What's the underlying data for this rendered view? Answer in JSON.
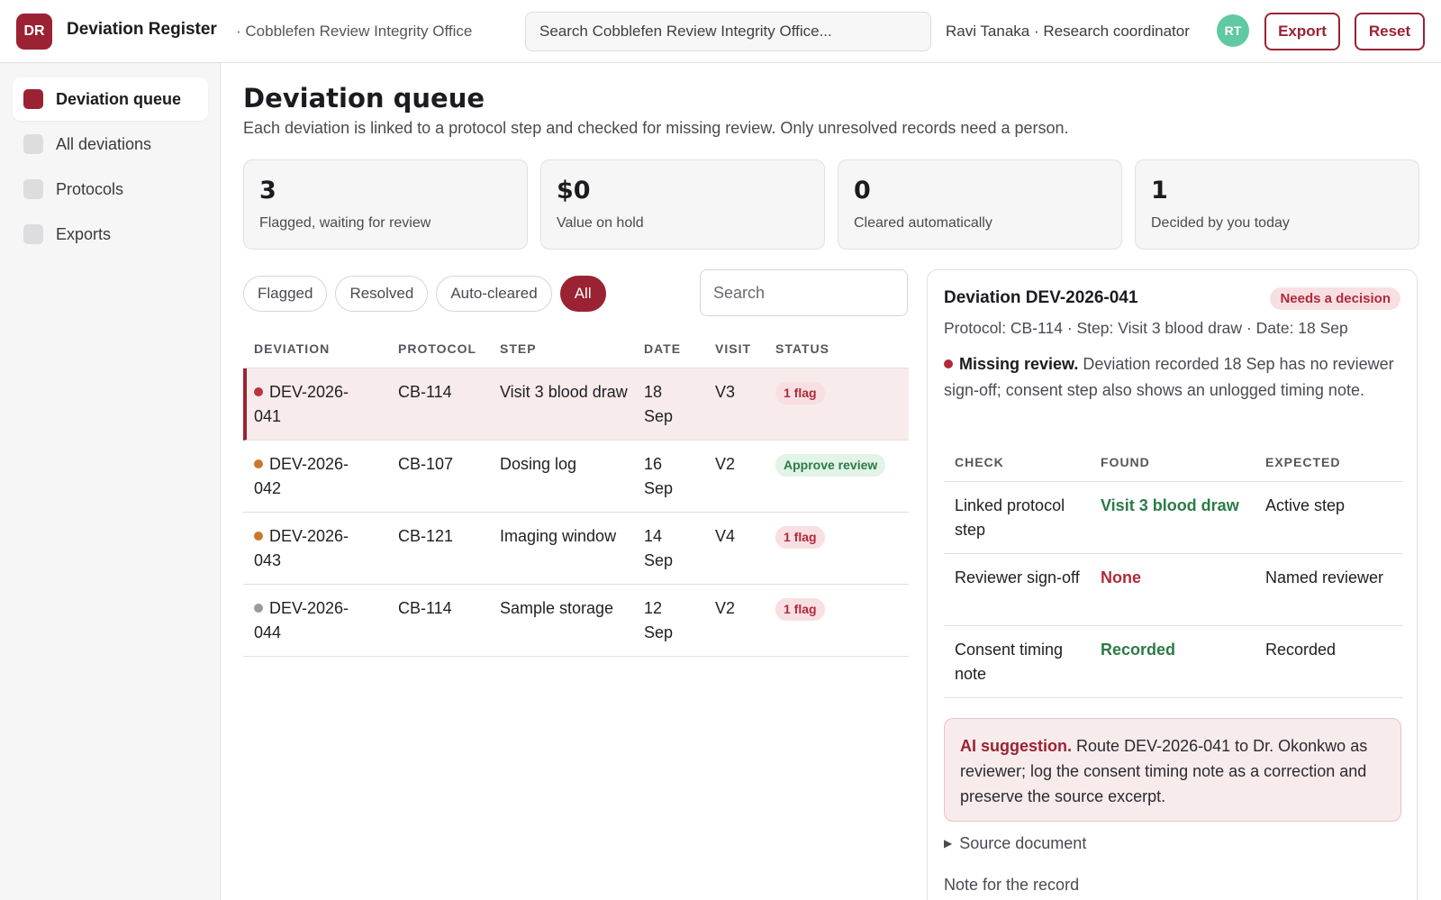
{
  "header": {
    "logo_initials": "DR",
    "app_title": "Deviation Register",
    "org": "· Cobblefen Review Integrity Office",
    "search_placeholder": "Search Cobblefen Review Integrity Office...",
    "user_label": "Ravi Tanaka · Research coordinator",
    "user_initials": "RT",
    "export_label": "Export",
    "reset_label": "Reset"
  },
  "sidebar": {
    "items": [
      {
        "label": "Deviation queue",
        "active": true
      },
      {
        "label": "All deviations",
        "active": false
      },
      {
        "label": "Protocols",
        "active": false
      },
      {
        "label": "Exports",
        "active": false
      }
    ]
  },
  "main": {
    "title": "Deviation queue",
    "subtitle": "Each deviation is linked to a protocol step and checked for missing review. Only unresolved records need a person.",
    "stats": [
      {
        "value": "3",
        "label": "Flagged, waiting for review"
      },
      {
        "value": "$0",
        "label": "Value on hold"
      },
      {
        "value": "0",
        "label": "Cleared automatically"
      },
      {
        "value": "1",
        "label": "Decided by you today"
      }
    ],
    "filters": [
      "Flagged",
      "Resolved",
      "Auto-cleared",
      "All"
    ],
    "active_filter": "All",
    "search_placeholder": "Search",
    "table": {
      "columns": [
        "DEVIATION",
        "PROTOCOL",
        "STEP",
        "DATE",
        "VISIT",
        "STATUS"
      ],
      "rows": [
        {
          "id_a": "DEV-2026-",
          "id_b": "041",
          "protocol": "CB-114",
          "step": "Visit 3 blood draw",
          "date_a": "18",
          "date_b": "Sep",
          "visit": "V3",
          "status": "1 flag",
          "status_type": "flag",
          "dot": "#b83440",
          "selected": true
        },
        {
          "id_a": "DEV-2026-",
          "id_b": "042",
          "protocol": "CB-107",
          "step": "Dosing log",
          "date_a": "16",
          "date_b": "Sep",
          "visit": "V2",
          "status": "Approve review",
          "status_type": "ok",
          "dot": "#c9782b",
          "selected": false
        },
        {
          "id_a": "DEV-2026-",
          "id_b": "043",
          "protocol": "CB-121",
          "step": "Imaging window",
          "date_a": "14",
          "date_b": "Sep",
          "visit": "V4",
          "status": "1 flag",
          "status_type": "flag",
          "dot": "#c9782b",
          "selected": false
        },
        {
          "id_a": "DEV-2026-",
          "id_b": "044",
          "protocol": "CB-114",
          "step": "Sample storage",
          "date_a": "12",
          "date_b": "Sep",
          "visit": "V2",
          "status": "1 flag",
          "status_type": "flag",
          "dot": "#9a9aa2",
          "selected": false
        }
      ]
    }
  },
  "detail": {
    "title": "Deviation DEV-2026-041",
    "badge": "Needs a decision",
    "meta": "Protocol: CB-114 · Step: Visit 3 blood draw · Date: 18 Sep",
    "issue_title": "Missing review.",
    "issue_text": "Deviation recorded 18 Sep has no reviewer sign-off; consent step also shows an unlogged timing note.",
    "checks": {
      "columns": [
        "CHECK",
        "FOUND",
        "EXPECTED"
      ],
      "rows": [
        {
          "check": "Linked protocol step",
          "found": "Visit 3 blood draw",
          "found_type": "ok",
          "expected": "Active step"
        },
        {
          "check": "Reviewer sign-off",
          "found": "None",
          "found_type": "bad",
          "expected": "Named reviewer"
        },
        {
          "check": "Consent timing note",
          "found": "Recorded",
          "found_type": "ok",
          "expected": "Recorded"
        }
      ]
    },
    "ai_title": "AI suggestion.",
    "ai_text": "Route DEV-2026-041 to Dr. Okonkwo as reviewer; log the consent timing note as a correction and preserve the source excerpt.",
    "source_label": "Source document",
    "note_label": "Note for the record"
  },
  "colors": {
    "accent": "#9b2232",
    "ok": "#2b7b46",
    "bad": "#b02a3a",
    "avatar": "#5fc9a2"
  }
}
